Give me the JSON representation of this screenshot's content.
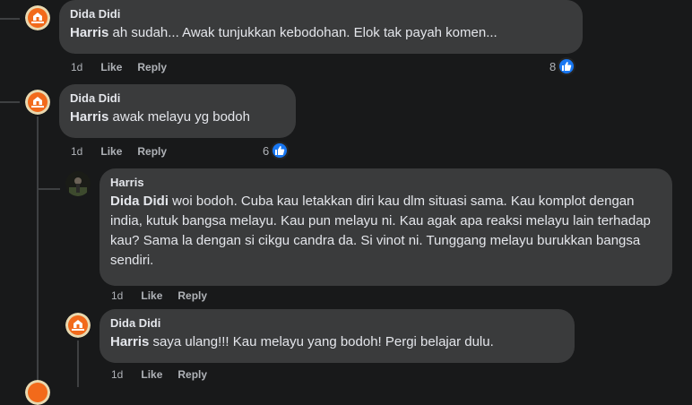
{
  "comments": [
    {
      "author": "Dida Didi",
      "mention": "Harris",
      "text": " ah sudah... Awak tunjukkan kebodohan. Elok tak payah komen...",
      "time": "1d",
      "like": "Like",
      "reply": "Reply",
      "reactions": "8"
    },
    {
      "author": "Dida Didi",
      "mention": "Harris",
      "text": " awak melayu yg bodoh",
      "time": "1d",
      "like": "Like",
      "reply": "Reply",
      "reactions": "6"
    }
  ],
  "replies": [
    {
      "author": "Harris",
      "mention": "Dida Didi",
      "text": " woi bodoh. Cuba kau letakkan diri kau dlm situasi sama. Kau komplot dengan india, kutuk bangsa melayu. Kau pun melayu ni. Kau agak apa reaksi melayu lain terhadap kau? Sama la dengan si cikgu candra da. Si vinot ni. Tunggang melayu burukkan bangsa sendiri.",
      "time": "1d",
      "like": "Like",
      "reply": "Reply"
    },
    {
      "author": "Dida Didi",
      "mention": "Harris",
      "text": " saya ulang!!! Kau melayu yang bodoh! Pergi belajar dulu.",
      "time": "1d",
      "like": "Like",
      "reply": "Reply"
    }
  ],
  "colors": {
    "background": "#18191a",
    "bubble": "#3a3b3c",
    "like_blue": "#1877f2",
    "avatar_orange": "#f26a1b"
  },
  "icons": {
    "avatar_dida": "temple-logo-icon",
    "avatar_harris": "person-photo-icon",
    "reaction": "thumbs-up-icon"
  }
}
